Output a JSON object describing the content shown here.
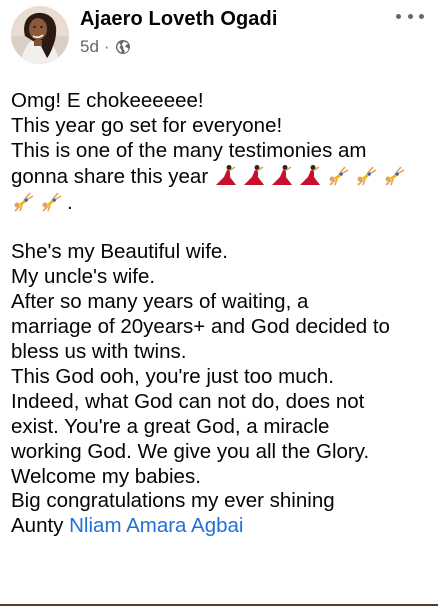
{
  "post": {
    "author": "Ajaero Loveth Ogadi",
    "time": "5d",
    "separator": "·",
    "privacy_icon": "globe-icon",
    "lines": [
      "Omg! E chokeeeeee!",
      "This year go set for everyone!",
      "This is one of the many testimonies am",
      "gonna share this year",
      ".",
      "She's my Beautiful wife.",
      "My uncle's wife.",
      "After so many years of waiting, a",
      "marriage of 20years+ and God decided to",
      "bless us with twins.",
      "This God ooh, you're just too much.",
      "Indeed, what God can not do, does not",
      "exist. You're a great God, a miracle",
      "working God. We give you all the Glory.",
      "Welcome my babies.",
      "Big congratulations my ever shining",
      "Aunty"
    ],
    "mention": "Nliam Amara Agbai",
    "emojis": [
      "dancer-emoji",
      "dancer-emoji",
      "dancer-emoji",
      "dancer-emoji",
      "cartwheel-emoji",
      "cartwheel-emoji",
      "cartwheel-emoji",
      "cartwheel-emoji",
      "cartwheel-emoji"
    ]
  },
  "colors": {
    "text": "#050505",
    "meta": "#65676b",
    "link": "#216fdb",
    "dancer": "#c8102e",
    "cartwheel_shirt": "#f5b800"
  }
}
